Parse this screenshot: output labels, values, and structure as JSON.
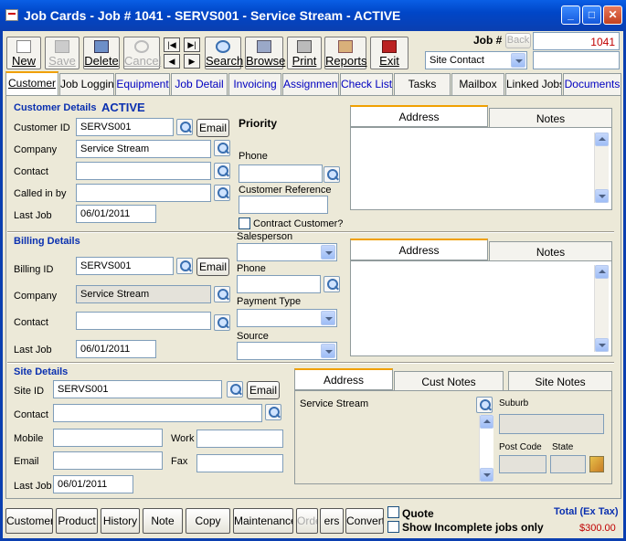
{
  "window": {
    "title": "Job Cards - Job # 1041 - SERVS001 - Service Stream - ACTIVE",
    "min": "_",
    "max": "□",
    "close": "✕"
  },
  "toolbar": {
    "new": "New",
    "save": "Save",
    "delete": "Delete",
    "cancel": "Cancel",
    "search": "Search",
    "browse": "Browse",
    "print": "Print",
    "reports": "Reports",
    "exit": "Exit",
    "nav_first": "|◀",
    "nav_last": "▶|",
    "nav_prev": "◀",
    "nav_next": "▶"
  },
  "job": {
    "label": "Job #",
    "back_label": "Back",
    "number": "1041",
    "contact_select": "Site Contact"
  },
  "tabs": [
    "Customer",
    "Job Logging",
    "Equipment",
    "Job Detail",
    "Invoicing",
    "Assignment",
    "Check List",
    "Tasks",
    "Mailbox",
    "Linked Jobs",
    "Documents"
  ],
  "customer": {
    "heading": "Customer Details",
    "status": "ACTIVE",
    "id_label": "Customer ID",
    "id": "SERVS001",
    "company_label": "Company",
    "company": "Service Stream",
    "contact_label": "Contact",
    "contact": "",
    "calledin_label": "Called in by",
    "calledin": "",
    "lastjob_label": "Last Job",
    "lastjob": "06/01/2011",
    "email_btn": "Email",
    "priority_label": "Priority",
    "phone_label": "Phone",
    "phone": "",
    "custref_label": "Customer Reference",
    "custref": "",
    "contract_label": "Contract Customer?"
  },
  "billing": {
    "heading": "Billing Details",
    "id_label": "Billing ID",
    "id": "SERVS001",
    "company_label": "Company",
    "company": "Service Stream",
    "contact_label": "Contact",
    "contact": "",
    "lastjob_label": "Last Job",
    "lastjob": "06/01/2011",
    "email_btn": "Email",
    "salesperson_label": "Salesperson",
    "phone_label": "Phone",
    "payment_label": "Payment Type",
    "source_label": "Source"
  },
  "site": {
    "heading": "Site Details",
    "id_label": "Site ID",
    "id": "SERVS001",
    "contact_label": "Contact",
    "mobile_label": "Mobile",
    "work_label": "Work",
    "email_label": "Email",
    "fax_label": "Fax",
    "lastjob_label": "Last Job",
    "lastjob": "06/01/2011",
    "email_btn": "Email"
  },
  "addr_tabs1": {
    "address": "Address",
    "notes": "Notes"
  },
  "addr_tabs2": {
    "address": "Address",
    "notes": "Notes"
  },
  "site_tabs": {
    "address": "Address",
    "cust_notes": "Cust Notes",
    "site_notes": "Site Notes"
  },
  "site_address": {
    "text": "Service Stream",
    "suburb_label": "Suburb",
    "postcode_label": "Post Code",
    "state_label": "State"
  },
  "bottom": {
    "customer": "Customer",
    "product": "Product",
    "history": "History",
    "note": "Note",
    "copy": "Copy",
    "maintenance": "Maintenance",
    "orders": "Orders",
    "ers": "ers",
    "convert": "Convert",
    "quote": "Quote",
    "show_incomplete": "Show Incomplete jobs only",
    "total_label": "Total (Ex Tax)",
    "total": "$300.00"
  },
  "colors": {
    "title": "#0046c8",
    "accent": "#0a30b0",
    "total": "#c00000"
  }
}
